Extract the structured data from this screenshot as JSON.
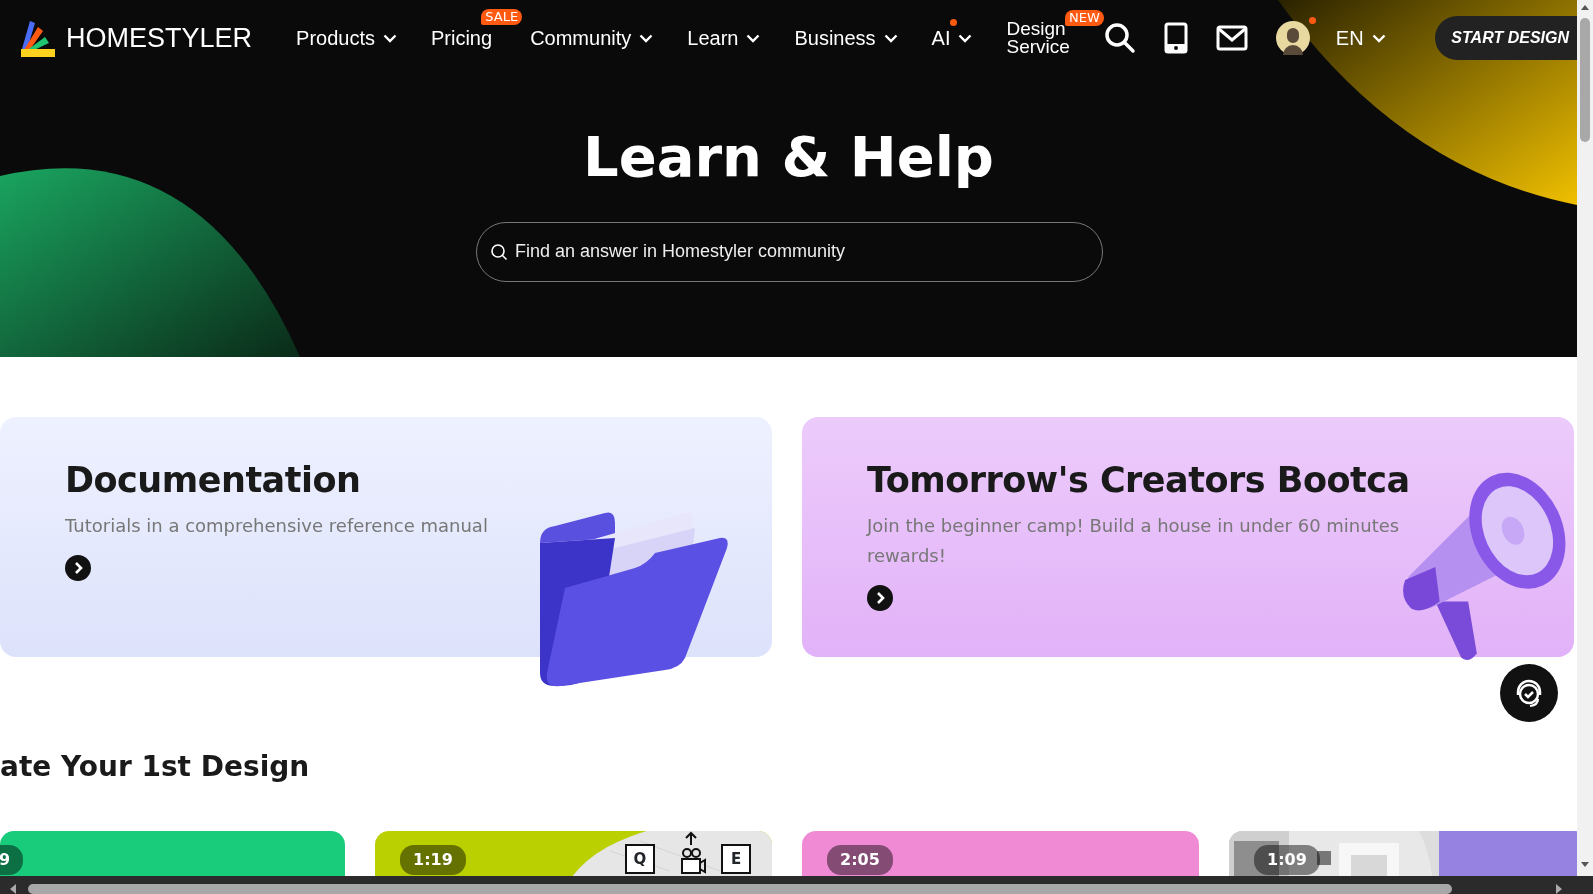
{
  "nav": {
    "logo": "HOMESTYLER",
    "items": [
      {
        "label": "Products",
        "dropdown": true
      },
      {
        "label": "Pricing",
        "dropdown": false,
        "badge": "SALE"
      },
      {
        "label": "Community",
        "dropdown": true
      },
      {
        "label": "Learn",
        "dropdown": true
      },
      {
        "label": "Business",
        "dropdown": true
      },
      {
        "label": "AI",
        "dropdown": true,
        "dot": true
      }
    ],
    "design_service": {
      "label_lines": [
        "Design",
        "Service"
      ],
      "badge": "NEW"
    },
    "avatar_dot": true,
    "language": "EN",
    "start_button": "START DESIGN"
  },
  "hero": {
    "title": "Learn & Help",
    "search": {
      "placeholder": "Find an answer in Homestyler community"
    }
  },
  "feature_cards": [
    {
      "kind": "folder",
      "title": "Documentation",
      "description_lines": [
        "Tutorials in a comprehensive reference manual"
      ]
    },
    {
      "kind": "megaphone",
      "title": "Tomorrow's Creators Bootca",
      "description_lines": [
        "Join the beginner camp! Build a house in under 60 minutes",
        "rewards!"
      ]
    }
  ],
  "section_title": "ate Your 1st Design",
  "videos": [
    {
      "kind": "plain",
      "duration": "9",
      "color": "#18cc7c"
    },
    {
      "kind": "keys",
      "duration": "1:19",
      "color": "#bad000",
      "keys": [
        "Q",
        "E"
      ]
    },
    {
      "kind": "plain",
      "duration": "2:05",
      "color": "#f08ad4"
    },
    {
      "duration": "1:09",
      "color": "#9682e0"
    }
  ]
}
